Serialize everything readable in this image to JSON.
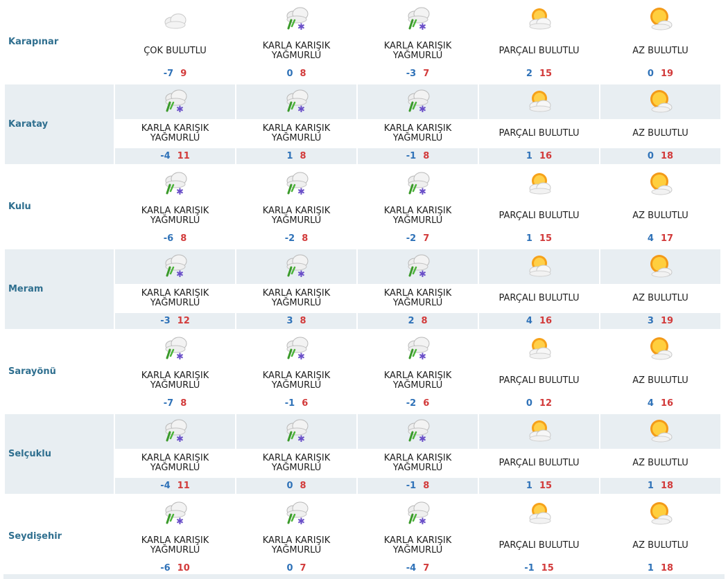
{
  "conditions": {
    "cloudy": "ÇOK BULUTLU",
    "sleet_line1": "KARLA KARIŞIK",
    "sleet_line2": "YAĞMURLU",
    "partly": "PARÇALI BULUTLU",
    "mostly_sunny": "AZ BULUTLU"
  },
  "icons": {
    "cloudy": "cloudy-icon",
    "sleet": "sleet-icon",
    "partly": "partly-cloudy-icon",
    "mostly_sunny": "mostly-sunny-icon"
  },
  "colors": {
    "low": "#2f72b8",
    "high": "#d23a3a",
    "city": "#2f6f8f",
    "row_shade": "#e8eef2"
  },
  "rows": [
    {
      "city": "Karapınar",
      "days": [
        {
          "cond": "cloudy",
          "lo": "-7",
          "hi": "9"
        },
        {
          "cond": "sleet",
          "lo": "0",
          "hi": "8"
        },
        {
          "cond": "sleet",
          "lo": "-3",
          "hi": "7"
        },
        {
          "cond": "partly",
          "lo": "2",
          "hi": "15"
        },
        {
          "cond": "mostly_sunny",
          "lo": "0",
          "hi": "19"
        }
      ]
    },
    {
      "city": "Karatay",
      "days": [
        {
          "cond": "sleet",
          "lo": "-4",
          "hi": "11"
        },
        {
          "cond": "sleet",
          "lo": "1",
          "hi": "8"
        },
        {
          "cond": "sleet",
          "lo": "-1",
          "hi": "8"
        },
        {
          "cond": "partly",
          "lo": "1",
          "hi": "16"
        },
        {
          "cond": "mostly_sunny",
          "lo": "0",
          "hi": "18"
        }
      ]
    },
    {
      "city": "Kulu",
      "days": [
        {
          "cond": "sleet",
          "lo": "-6",
          "hi": "8"
        },
        {
          "cond": "sleet",
          "lo": "-2",
          "hi": "8"
        },
        {
          "cond": "sleet",
          "lo": "-2",
          "hi": "7"
        },
        {
          "cond": "partly",
          "lo": "1",
          "hi": "15"
        },
        {
          "cond": "mostly_sunny",
          "lo": "4",
          "hi": "17"
        }
      ]
    },
    {
      "city": "Meram",
      "days": [
        {
          "cond": "sleet",
          "lo": "-3",
          "hi": "12"
        },
        {
          "cond": "sleet",
          "lo": "3",
          "hi": "8"
        },
        {
          "cond": "sleet",
          "lo": "2",
          "hi": "8"
        },
        {
          "cond": "partly",
          "lo": "4",
          "hi": "16"
        },
        {
          "cond": "mostly_sunny",
          "lo": "3",
          "hi": "19"
        }
      ]
    },
    {
      "city": "Sarayönü",
      "days": [
        {
          "cond": "sleet",
          "lo": "-7",
          "hi": "8"
        },
        {
          "cond": "sleet",
          "lo": "-1",
          "hi": "6"
        },
        {
          "cond": "sleet",
          "lo": "-2",
          "hi": "6"
        },
        {
          "cond": "partly",
          "lo": "0",
          "hi": "12"
        },
        {
          "cond": "mostly_sunny",
          "lo": "4",
          "hi": "16"
        }
      ]
    },
    {
      "city": "Selçuklu",
      "days": [
        {
          "cond": "sleet",
          "lo": "-4",
          "hi": "11"
        },
        {
          "cond": "sleet",
          "lo": "0",
          "hi": "8"
        },
        {
          "cond": "sleet",
          "lo": "-1",
          "hi": "8"
        },
        {
          "cond": "partly",
          "lo": "1",
          "hi": "15"
        },
        {
          "cond": "mostly_sunny",
          "lo": "1",
          "hi": "18"
        }
      ]
    },
    {
      "city": "Seydişehir",
      "days": [
        {
          "cond": "sleet",
          "lo": "-6",
          "hi": "10"
        },
        {
          "cond": "sleet",
          "lo": "0",
          "hi": "7"
        },
        {
          "cond": "sleet",
          "lo": "-4",
          "hi": "7"
        },
        {
          "cond": "partly",
          "lo": "-1",
          "hi": "15"
        },
        {
          "cond": "mostly_sunny",
          "lo": "1",
          "hi": "18"
        }
      ]
    }
  ]
}
